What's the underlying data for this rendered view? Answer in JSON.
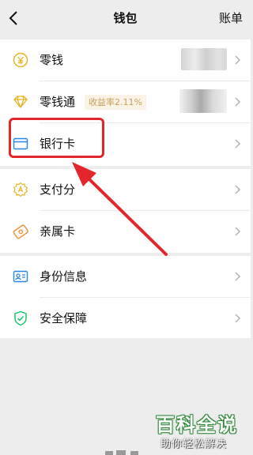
{
  "header": {
    "title": "钱包",
    "bill_label": "账单"
  },
  "menu": {
    "group1": [
      {
        "label": "零钱",
        "icon": "coin-icon"
      },
      {
        "label": "零钱通",
        "badge": "收益率2.11%",
        "icon": "diamond-icon"
      },
      {
        "label": "银行卡",
        "icon": "bank-card-icon"
      }
    ],
    "group2": [
      {
        "label": "支付分",
        "icon": "pay-score-icon"
      },
      {
        "label": "亲属卡",
        "icon": "family-card-icon"
      }
    ],
    "group3": [
      {
        "label": "身份信息",
        "icon": "id-card-icon"
      },
      {
        "label": "安全保障",
        "icon": "shield-icon"
      }
    ]
  },
  "watermark": {
    "title": "百科全说",
    "subtitle": "助你轻松解决"
  },
  "colors": {
    "accent_green": "#07c160",
    "highlight_red": "#e3262b",
    "badge_text": "#c9a05a",
    "icon_gold": "#e6b422"
  }
}
